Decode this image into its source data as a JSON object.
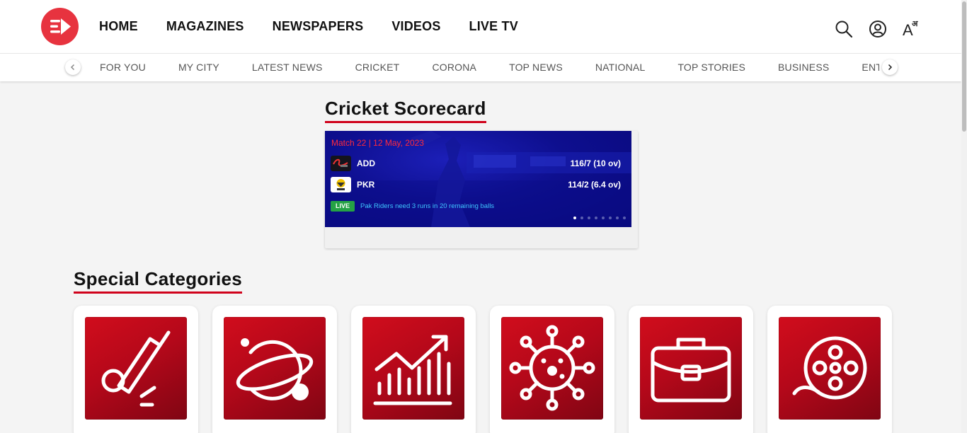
{
  "header": {
    "main_nav": [
      "HOME",
      "MAGAZINES",
      "NEWSPAPERS",
      "VIDEOS",
      "LIVE TV"
    ],
    "icons": [
      "search-icon",
      "user-profile-icon",
      "language-font-icon"
    ],
    "language_icon_text": "A",
    "language_icon_sup": "अ"
  },
  "sub_nav": {
    "items": [
      "FOR YOU",
      "MY CITY",
      "LATEST NEWS",
      "CRICKET",
      "CORONA",
      "TOP NEWS",
      "NATIONAL",
      "TOP STORIES",
      "BUSINESS",
      "ENTERTAINMENT"
    ]
  },
  "scorecard_section": {
    "title": "Cricket Scorecard",
    "match_info": "Match 22 | 12 May, 2023",
    "teams": [
      {
        "name": "ADD",
        "score": "116/7 (10 ov)"
      },
      {
        "name": "PKR",
        "score": "114/2 (6.4 ov)"
      }
    ],
    "live_label": "LIVE",
    "status": "Pak Riders need 3 runs in 20 remaining balls",
    "slide_count": 8,
    "active_slide": 1
  },
  "categories_section": {
    "title": "Special Categories",
    "items": [
      {
        "icon": "cricket-icon"
      },
      {
        "icon": "planet-icon"
      },
      {
        "icon": "growth-chart-icon"
      },
      {
        "icon": "virus-icon"
      },
      {
        "icon": "briefcase-icon"
      },
      {
        "icon": "film-reel-icon"
      }
    ]
  },
  "colors": {
    "accent": "#d0021b",
    "logo": "#e7333f",
    "tile": "#b5081a",
    "live": "#25a245",
    "banner": "#0e0f8f"
  }
}
